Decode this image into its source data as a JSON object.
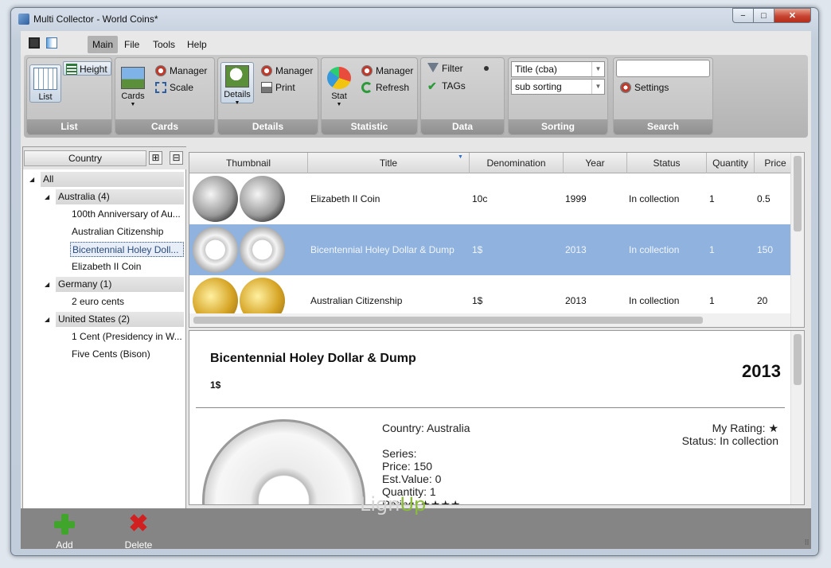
{
  "window": {
    "title": "Multi Collector - World Coins*",
    "min_glyph": "−",
    "max_glyph": "□",
    "close_glyph": "✕"
  },
  "menu": {
    "items": [
      {
        "label": "Main",
        "active": true
      },
      {
        "label": "File"
      },
      {
        "label": "Tools"
      },
      {
        "label": "Help"
      }
    ]
  },
  "ribbon": {
    "list": {
      "label": "List",
      "list_btn": "List",
      "height_btn": "Height"
    },
    "cards": {
      "label": "Cards",
      "cards_btn": "Cards",
      "manager": "Manager",
      "scale": "Scale"
    },
    "details": {
      "label": "Details",
      "details_btn": "Details",
      "manager": "Manager",
      "print": "Print"
    },
    "statistic": {
      "label": "Statistic",
      "stat_btn": "Stat",
      "manager": "Manager",
      "refresh": "Refresh"
    },
    "data": {
      "label": "Data",
      "filter": "Filter",
      "tags": "TAGs"
    },
    "sorting": {
      "label": "Sorting",
      "sort1": "Title (cba)",
      "sort2": "sub sorting"
    },
    "search": {
      "label": "Search",
      "query": "",
      "settings": "Settings"
    }
  },
  "tree": {
    "header": "Country",
    "expand_glyph": "⊞",
    "collapse_glyph": "⊟",
    "nodes": [
      {
        "label": "All",
        "level": 0
      },
      {
        "label": "Australia (4)",
        "level": 1
      },
      {
        "label": "100th Anniversary of Au...",
        "level": 2
      },
      {
        "label": "Australian Citizenship",
        "level": 2
      },
      {
        "label": "Bicentennial Holey Doll...",
        "level": 2,
        "selected": true
      },
      {
        "label": "Elizabeth II Coin",
        "level": 2
      },
      {
        "label": "Germany (1)",
        "level": 1
      },
      {
        "label": "2 euro cents",
        "level": 2
      },
      {
        "label": "United States (2)",
        "level": 1
      },
      {
        "label": "1 Cent (Presidency in W...",
        "level": 2
      },
      {
        "label": "Five Cents (Bison)",
        "level": 2
      }
    ]
  },
  "grid": {
    "columns": [
      "Thumbnail",
      "Title",
      "Denomination",
      "Year",
      "Status",
      "Quantity",
      "Price"
    ],
    "rows": [
      {
        "title": "Elizabeth II Coin",
        "denomination": "10c",
        "year": "1999",
        "status": "In collection",
        "quantity": "1",
        "price": "0.5"
      },
      {
        "title": "Bicentennial Holey Dollar & Dump",
        "denomination": "1$",
        "year": "2013",
        "status": "In collection",
        "quantity": "1",
        "price": "150"
      },
      {
        "title": "Australian Citizenship",
        "denomination": "1$",
        "year": "2013",
        "status": "In collection",
        "quantity": "1",
        "price": "20"
      }
    ]
  },
  "detail": {
    "title": "Bicentennial Holey Dollar & Dump",
    "denomination": "1$",
    "year": "2013",
    "country": "Country: Australia",
    "series": "Series:",
    "price": "Price: 150",
    "est_value": "Est.Value: 0",
    "quantity": "Quantity: 1",
    "rating": "Rating: ★★★★",
    "my_rating": "My Rating: ★",
    "status": "Status: In collection"
  },
  "bottom": {
    "add": "Add",
    "delete": "Delete",
    "delete_glyph": "✖",
    "logo_a": "Lign",
    "logo_b": "Up",
    "grip": "⠿"
  }
}
